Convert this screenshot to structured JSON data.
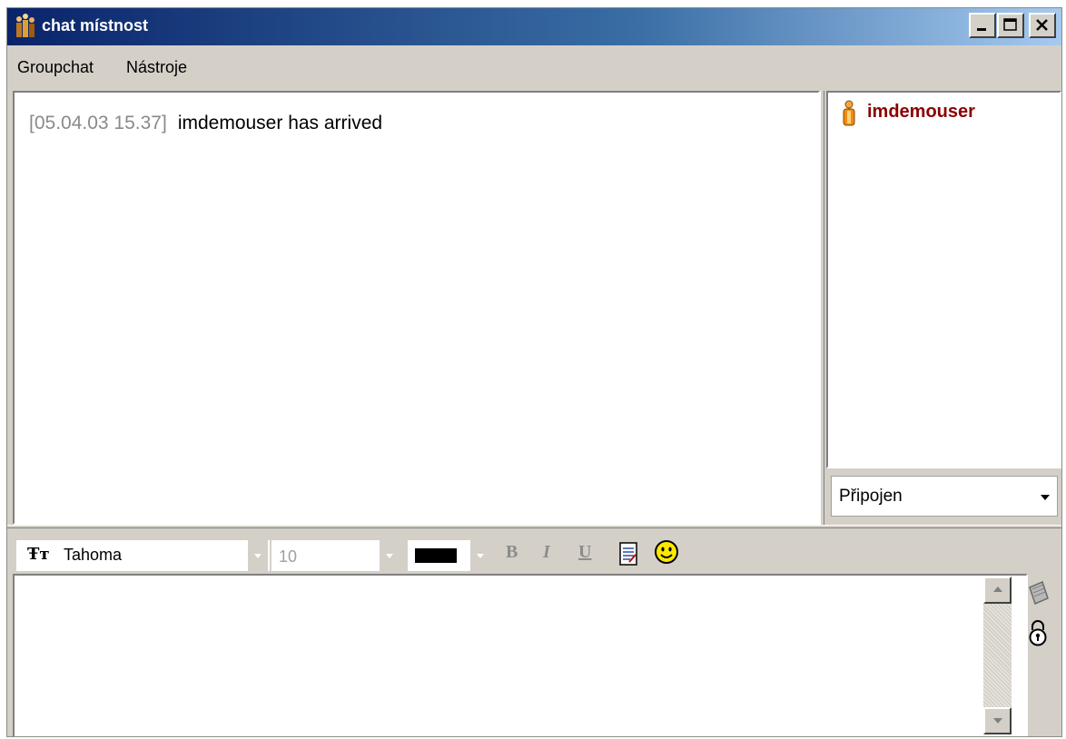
{
  "window": {
    "title": "chat místnost"
  },
  "menubar": {
    "items": [
      "Groupchat",
      "Nástroje"
    ]
  },
  "chat": {
    "messages": [
      {
        "timestamp": "[05.04.03 15.37]",
        "text": "imdemouser has arrived"
      }
    ]
  },
  "roster": {
    "users": [
      {
        "name": "imdemouser",
        "color": "#8b0000"
      }
    ]
  },
  "status": {
    "selected": "Připojen"
  },
  "toolbar": {
    "font_family": "Tahoma",
    "font_size": "10",
    "text_color": "#000000",
    "bold_label": "B",
    "italic_label": "I",
    "underline_label": "U"
  },
  "icons": [
    "app-icon",
    "minimize-icon",
    "maximize-icon",
    "close-icon",
    "user-icon",
    "dropdown-arrow-icon",
    "font-icon",
    "notepad-icon",
    "smiley-icon",
    "scroll-up-icon",
    "scroll-down-icon",
    "send-icon",
    "lock-icon"
  ]
}
